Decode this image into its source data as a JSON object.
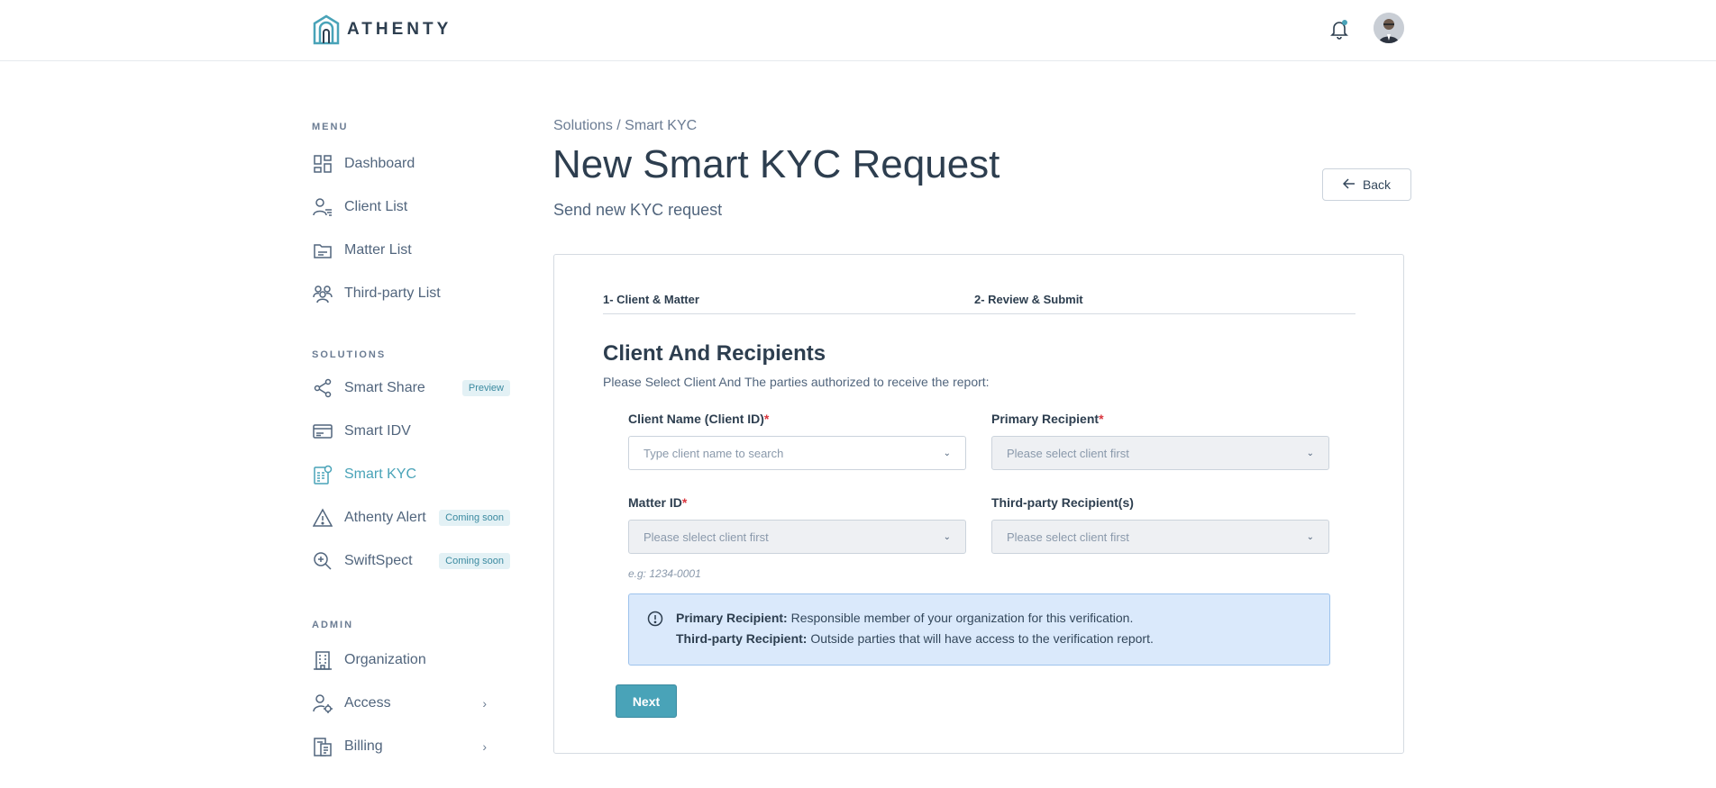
{
  "header": {
    "logo_text": "ATHENTY",
    "notification_icon": "bell-icon",
    "avatar_icon": "user-avatar"
  },
  "sidebar": {
    "menu_title": "MENU",
    "menu_items": [
      {
        "label": "Dashboard",
        "icon": "grid-icon"
      },
      {
        "label": "Client List",
        "icon": "user-list-icon"
      },
      {
        "label": "Matter List",
        "icon": "folder-icon"
      },
      {
        "label": "Third-party List",
        "icon": "group-icon"
      }
    ],
    "solutions_title": "SOLUTIONS",
    "solutions_items": [
      {
        "label": "Smart Share",
        "icon": "share-icon",
        "badge": "Preview"
      },
      {
        "label": "Smart IDV",
        "icon": "id-card-icon"
      },
      {
        "label": "Smart KYC",
        "icon": "kyc-icon",
        "active": true
      },
      {
        "label": "Athenty Alert",
        "icon": "alert-icon",
        "badge": "Coming soon"
      },
      {
        "label": "SwiftSpect",
        "icon": "zoom-in-icon",
        "badge": "Coming soon"
      }
    ],
    "admin_title": "ADMIN",
    "admin_items": [
      {
        "label": "Organization",
        "icon": "building-icon"
      },
      {
        "label": "Access",
        "icon": "user-gear-icon",
        "chevron": "›"
      },
      {
        "label": "Billing",
        "icon": "billing-icon",
        "chevron": "›"
      }
    ]
  },
  "main": {
    "breadcrumb": "Solutions / Smart KYC",
    "title": "New Smart KYC Request",
    "subtitle": "Send new KYC request",
    "back_label": "Back",
    "steps": [
      "1- Client & Matter",
      "2- Review & Submit"
    ],
    "section_heading": "Client And Recipients",
    "section_desc": "Please Select Client And The parties authorized to receive the report:",
    "fields": {
      "client": {
        "label": "Client Name (Client ID)",
        "required": "*",
        "placeholder": "Type client name to search"
      },
      "primary": {
        "label": "Primary Recipient",
        "required": "*",
        "placeholder": "Please select client first"
      },
      "matter": {
        "label": "Matter ID",
        "required": "*",
        "placeholder": "Please slelect client first",
        "hint": "e.g: 1234-0001"
      },
      "third_party": {
        "label": "Third-party Recipient(s)",
        "placeholder": "Please select client first"
      }
    },
    "info": {
      "primary_title": "Primary Recipient:",
      "primary_text": " Responsible member of your organization for this verification.",
      "third_title": "Third-party Recipient:",
      "third_text": " Outside parties that will have access to the verification report."
    },
    "next_label": "Next"
  },
  "colors": {
    "accent": "#49a3b8",
    "info_bg": "#dae9fb",
    "required": "#d9363e"
  }
}
